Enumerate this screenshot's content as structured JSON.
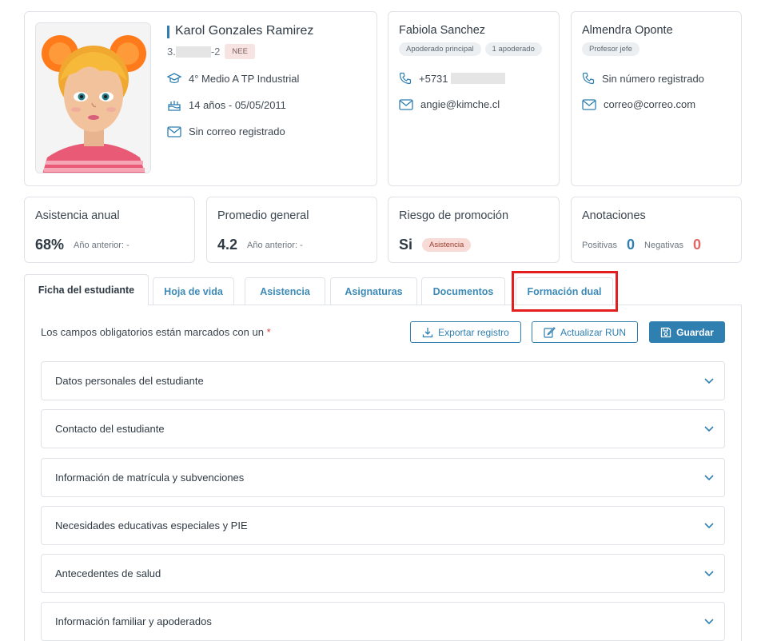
{
  "student": {
    "name": "Karol Gonzales Ramirez",
    "rut_prefix": "3.",
    "rut_suffix": "-2",
    "nee_badge": "NEE",
    "course": "4° Medio A TP Industrial",
    "age_birth": "14 años - 05/05/2011",
    "email": "Sin correo registrado"
  },
  "guardian": {
    "name": "Fabiola Sanchez",
    "badges": [
      "Apoderado principal",
      "1 apoderado"
    ],
    "phone_prefix": "+5731",
    "email": "angie@kimche.cl"
  },
  "teacher": {
    "name": "Almendra Oponte",
    "badge": "Profesor jefe",
    "phone": "Sin número registrado",
    "email": "correo@correo.com"
  },
  "stats": {
    "attendance": {
      "title": "Asistencia anual",
      "value": "68%",
      "prev": "Año anterior: -"
    },
    "average": {
      "title": "Promedio general",
      "value": "4.2",
      "prev": "Año anterior: -"
    },
    "risk": {
      "title": "Riesgo de promoción",
      "value": "Si",
      "badge": "Asistencia"
    },
    "annotations": {
      "title": "Anotaciones",
      "positive_label": "Positivas",
      "positive_value": "0",
      "negative_label": "Negativas",
      "negative_value": "0"
    }
  },
  "tabs": [
    "Ficha del estudiante",
    "Hoja de vida",
    "Asistencia",
    "Asignaturas",
    "Documentos",
    "Formación dual"
  ],
  "panel": {
    "required_note": "Los campos obligatorios están marcados con un",
    "required_star": "*",
    "buttons": {
      "export": "Exportar registro",
      "update_run": "Actualizar RUN",
      "save": "Guardar"
    },
    "sections": [
      "Datos personales del estudiante",
      "Contacto del estudiante",
      "Información de matrícula y subvenciones",
      "Necesidades educativas especiales y PIE",
      "Antecedentes de salud",
      "Información familiar y apoderados"
    ]
  },
  "colors": {
    "accent": "#2f7fb1",
    "positive": "#2f7fb1",
    "negative": "#e06666",
    "highlight": "#e41e1e"
  },
  "icons": [
    "graduation-cap-icon",
    "cake-icon",
    "mail-icon",
    "phone-icon",
    "download-icon",
    "edit-icon",
    "save-icon",
    "chevron-down-icon"
  ]
}
